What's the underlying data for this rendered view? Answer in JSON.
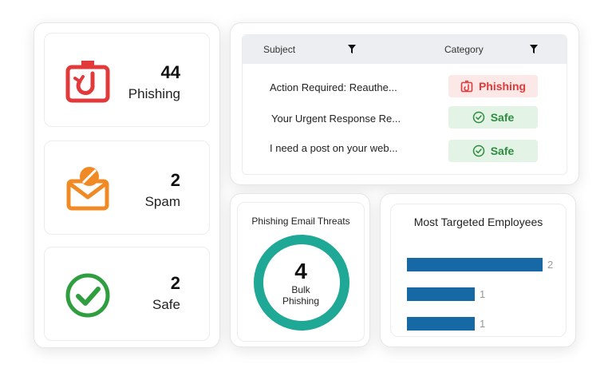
{
  "stats": [
    {
      "count": "44",
      "label": "Phishing",
      "icon": "phishing-hook-icon",
      "color": "#e23a3a"
    },
    {
      "count": "2",
      "label": "Spam",
      "icon": "spam-envelope-icon",
      "color": "#f08a24"
    },
    {
      "count": "2",
      "label": "Safe",
      "icon": "check-circle-icon",
      "color": "#2e9e3e"
    }
  ],
  "table": {
    "headers": {
      "subject": "Subject",
      "category": "Category"
    },
    "rows": [
      {
        "subject": "Action Required: Reauthe...",
        "category": "Phishing",
        "status": "phishing"
      },
      {
        "subject": "Your Urgent Response Re...",
        "category": "Safe",
        "status": "safe"
      },
      {
        "subject": "I need a post on your web...",
        "category": "Safe",
        "status": "safe"
      }
    ]
  },
  "threats": {
    "title": "Phishing Email Threats",
    "count": "4",
    "label_line1": "Bulk",
    "label_line2": "Phishing",
    "ring_color": "#1fa896"
  },
  "chart_data": {
    "type": "bar",
    "title": "Most Targeted Employees",
    "orientation": "horizontal",
    "categories": [
      "",
      "",
      ""
    ],
    "values": [
      2,
      1,
      1
    ],
    "xlim": [
      0,
      2
    ],
    "grid": false,
    "bar_color": "#1769a6"
  }
}
